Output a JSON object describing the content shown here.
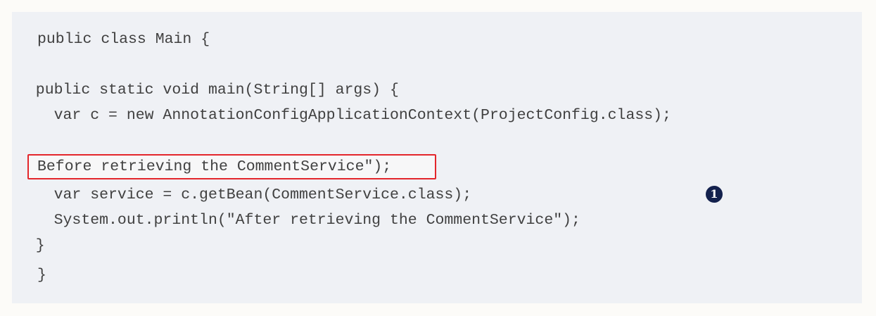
{
  "code": {
    "line1": "public class Main {",
    "line2": "  public static void main(String[] args) {",
    "line3": "    var c = new AnnotationConfigApplicationContext(ProjectConfig.class);",
    "line4": "Before retrieving the CommentService\");",
    "line5": "    var service = c.getBean(CommentService.class);",
    "line6": "    System.out.println(\"After retrieving the CommentService\");",
    "line7": "  }",
    "line8": "}"
  },
  "callout": {
    "number": "1"
  },
  "colors": {
    "code_background": "#eff1f5",
    "highlight_border": "#e3262b",
    "callout_background": "#13214d",
    "code_text": "#404040"
  }
}
